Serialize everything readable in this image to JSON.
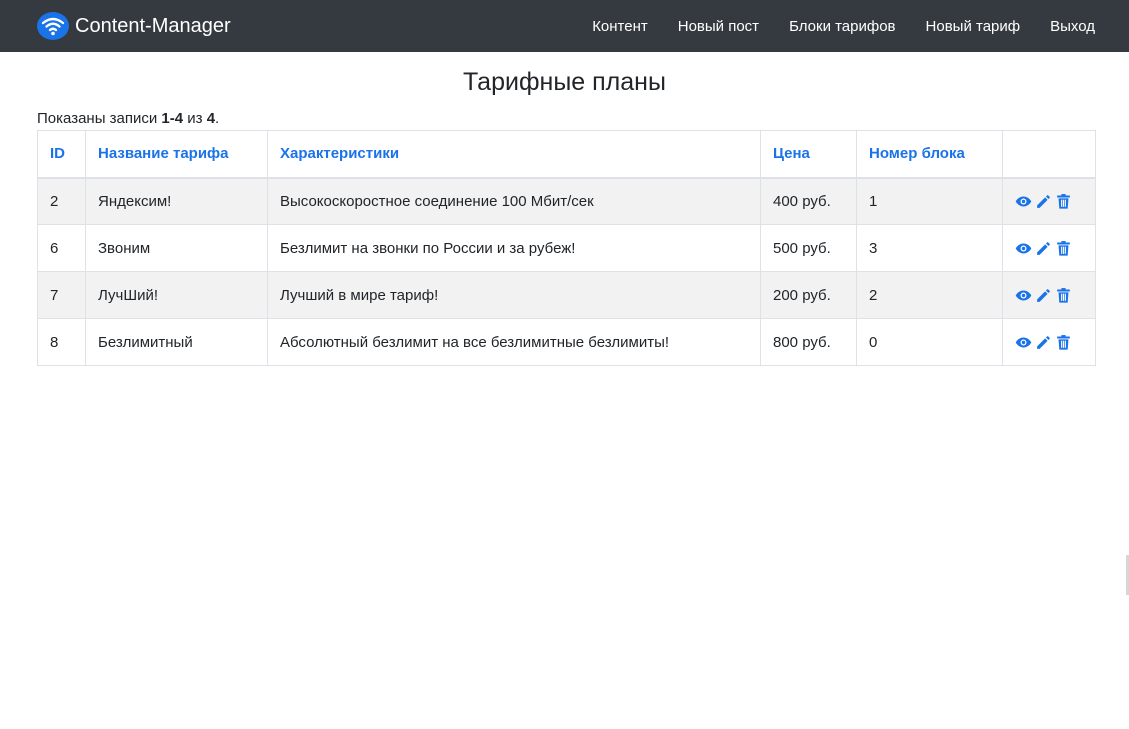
{
  "navbar": {
    "brand": "Content-Manager",
    "brand_icon": "wifi-icon",
    "brand_color": "#1a73e8",
    "background": "#343a40",
    "links": [
      {
        "label": "Контент",
        "name": "nav-content"
      },
      {
        "label": "Новый пост",
        "name": "nav-new-post"
      },
      {
        "label": "Блоки тарифов",
        "name": "nav-tariff-blocks"
      },
      {
        "label": "Новый тариф",
        "name": "nav-new-tariff"
      },
      {
        "label": "Выход",
        "name": "nav-logout"
      }
    ]
  },
  "page": {
    "title": "Тарифные планы"
  },
  "summary": {
    "prefix": "Показаны записи ",
    "range": "1-4",
    "middle": " из ",
    "total": "4",
    "suffix": "."
  },
  "table": {
    "columns": [
      "ID",
      "Название тарифа",
      "Характеристики",
      "Цена",
      "Номер блока",
      ""
    ],
    "rows": [
      {
        "id": "2",
        "name": "Яндексим!",
        "features": "Высокоскоростное соединение 100 Мбит/сек",
        "price": "400 руб.",
        "block": "1"
      },
      {
        "id": "6",
        "name": "Звоним",
        "features": "Безлимит на звонки по России и за рубеж!",
        "price": "500 руб.",
        "block": "3"
      },
      {
        "id": "7",
        "name": "ЛучШий!",
        "features": "Лучший в мире тариф!",
        "price": "200 руб.",
        "block": "2"
      },
      {
        "id": "8",
        "name": "Безлимитный",
        "features": "Абсолютный безлимит на все безлимитные безлимиты!",
        "price": "800 руб.",
        "block": "0"
      }
    ],
    "action_icons": [
      "eye-icon",
      "pencil-icon",
      "trash-icon"
    ],
    "link_color": "#1a73e8"
  }
}
